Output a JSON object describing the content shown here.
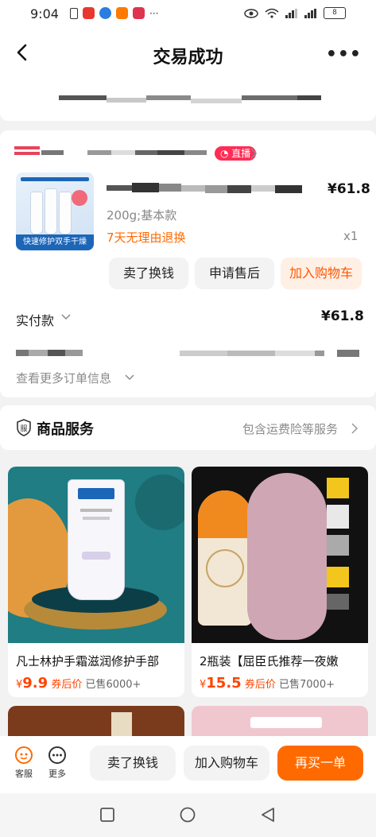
{
  "status_bar": {
    "time": "9:04",
    "battery": "8"
  },
  "header": {
    "title": "交易成功"
  },
  "shop": {
    "live_badge": "直播"
  },
  "product": {
    "thumb_banner": "快速修护双手干燥",
    "price": "¥61.8",
    "spec": "200g;基本款",
    "return_policy": "7天无理由退换",
    "quantity": "x1"
  },
  "actions": {
    "sell": "卖了换钱",
    "after_sale": "申请售后",
    "add_cart": "加入购物车"
  },
  "payment": {
    "label": "实付款",
    "amount": "¥61.8"
  },
  "more_info": "查看更多订单信息",
  "service": {
    "title": "商品服务",
    "link": "包含运费险等服务"
  },
  "recommendations": [
    {
      "name": "凡士林护手霜滋润修护手部",
      "price": "9.9",
      "price_note": "券后价",
      "sold": "已售6000+"
    },
    {
      "name": "2瓶装【屈臣氏推荐一夜嫩",
      "price": "15.5",
      "price_note": "券后价",
      "sold": "已售7000+"
    }
  ],
  "bottom_bar": {
    "service_label": "客服",
    "more_label": "更多",
    "sell": "卖了换钱",
    "add_cart": "加入购物车",
    "buy_again": "再买一单"
  },
  "colors": {
    "accent": "#ff6a00",
    "price_red": "#ff4400",
    "policy_orange": "#ff6a00"
  }
}
